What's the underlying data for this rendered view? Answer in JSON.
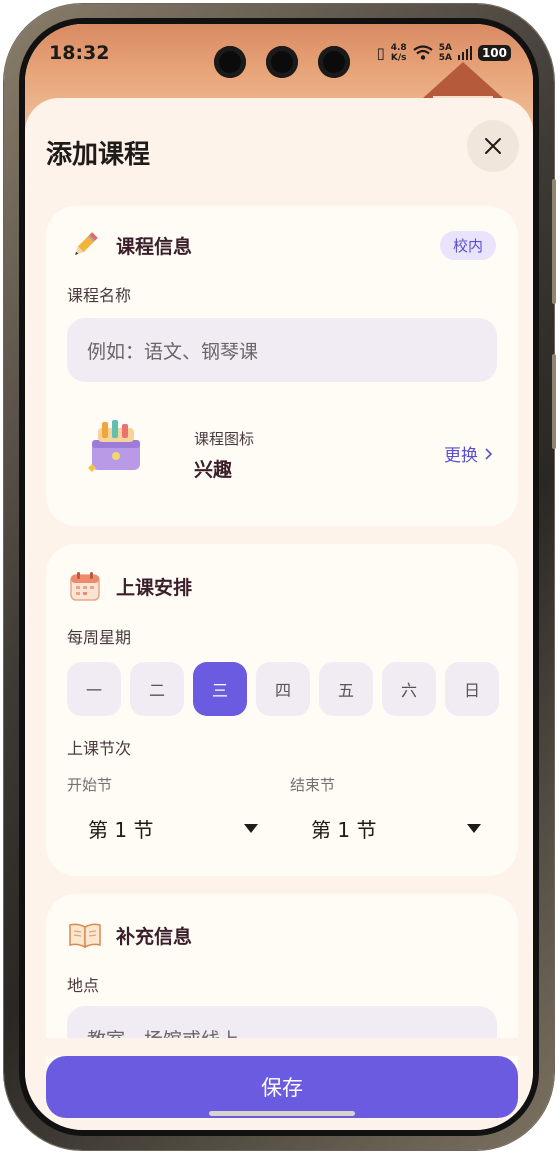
{
  "status_bar": {
    "time": "18:32",
    "net_speed_top": "4.8",
    "net_speed_bottom": "K/s",
    "signal_top": "5A",
    "signal_bottom": "5A",
    "battery": "100"
  },
  "sheet": {
    "title": "添加课程",
    "save_label": "保存"
  },
  "course_info": {
    "title": "课程信息",
    "tag": "校内",
    "name_label": "课程名称",
    "name_placeholder": "例如：语文、钢琴课",
    "icon_label": "课程图标",
    "icon_value": "兴趣",
    "change_label": "更换"
  },
  "schedule": {
    "title": "上课安排",
    "weekday_label": "每周星期",
    "weekdays": [
      "一",
      "二",
      "三",
      "四",
      "五",
      "六",
      "日"
    ],
    "selected_weekday": "三",
    "period_label": "上课节次",
    "start_label": "开始节",
    "start_value": "第 1 节",
    "end_label": "结束节",
    "end_value": "第 1 节"
  },
  "extra": {
    "title": "补充信息",
    "location_label": "地点",
    "location_placeholder": "教室、场馆或线上"
  },
  "colors": {
    "accent": "#6a5be0",
    "sheet_bg": "#fdf3ea",
    "card_bg": "#fffbf5",
    "input_bg": "#f1ecf3"
  },
  "icons": {
    "course_info": "pencil-icon",
    "schedule": "calendar-icon",
    "extra": "open-book-icon",
    "course_icon": "toolbox-icon"
  }
}
